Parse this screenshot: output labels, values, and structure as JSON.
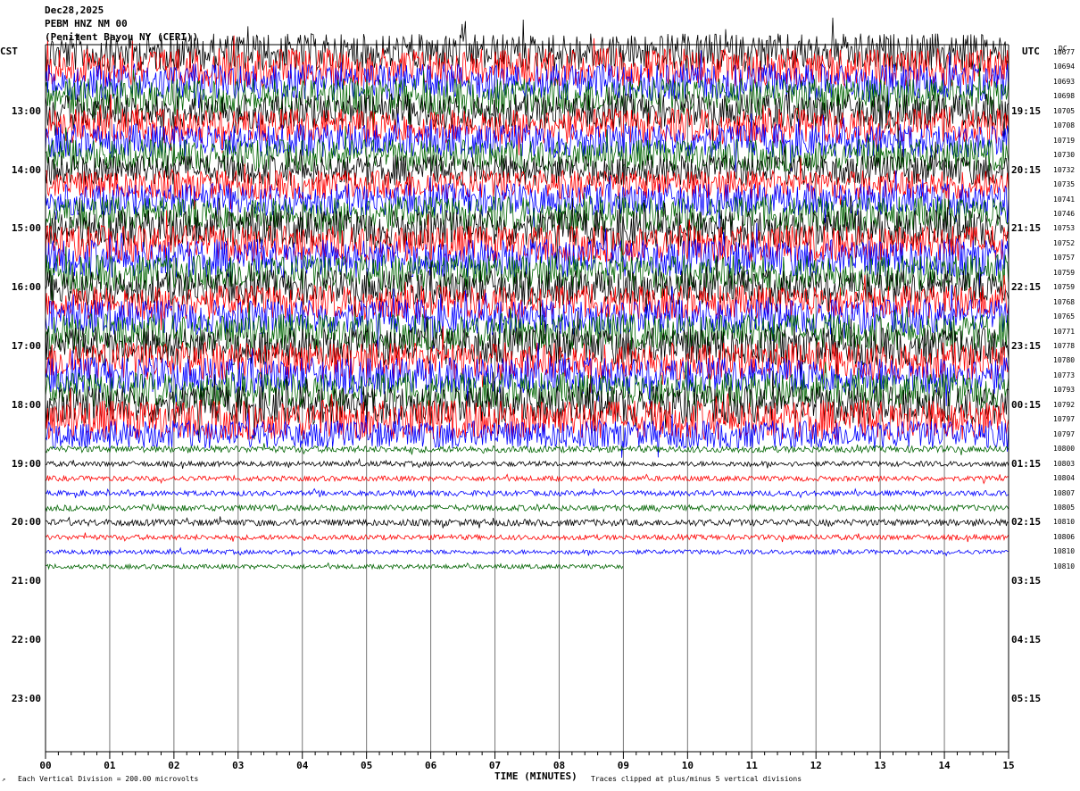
{
  "header": {
    "date": "Dec28,2025",
    "station": "PEBM HNZ NM 00",
    "location": "(Penitent Bayou NY (CERI))"
  },
  "tz_left": "CST",
  "tz_right": "UTC",
  "dc_header": "DC",
  "colors": {
    "sequence": [
      "#000000",
      "#ff0000",
      "#0000ff",
      "#006400"
    ]
  },
  "chart_data": {
    "type": "helicorder",
    "title": "",
    "xlabel": "TIME (MINUTES)",
    "x_ticks": [
      "00",
      "01",
      "02",
      "03",
      "04",
      "05",
      "06",
      "07",
      "08",
      "09",
      "10",
      "11",
      "12",
      "13",
      "14",
      "15"
    ],
    "xlim": [
      0,
      15
    ],
    "rows_per_hour": 4,
    "row_minutes": 15,
    "start_time_local": "12:15",
    "left_hour_labels": [
      "13:00",
      "14:00",
      "15:00",
      "16:00",
      "17:00",
      "18:00",
      "19:00",
      "20:00",
      "21:00",
      "22:00",
      "23:00"
    ],
    "right_hour_labels": [
      "19:15",
      "20:15",
      "21:15",
      "22:15",
      "23:15",
      "00:15",
      "01:15",
      "02:15",
      "03:15",
      "04:15",
      "05:15"
    ],
    "dc_offsets": [
      10677,
      10694,
      10693,
      10698,
      10705,
      10708,
      10719,
      10730,
      10732,
      10735,
      10741,
      10746,
      10753,
      10752,
      10757,
      10759,
      10759,
      10768,
      10765,
      10771,
      10778,
      10780,
      10773,
      10793,
      10792,
      10797,
      10797,
      10800,
      10803,
      10804,
      10807,
      10805,
      10810,
      10806,
      10810,
      10810
    ],
    "trace_rows": 36,
    "last_row_end_minutes": 9,
    "amplitude_profile": [
      2.6,
      2.6,
      2.5,
      2.5,
      2.4,
      2.4,
      2.3,
      2.2,
      2.1,
      2.0,
      2.2,
      2.4,
      2.6,
      2.5,
      2.6,
      2.5,
      2.4,
      2.3,
      2.4,
      2.5,
      2.6,
      2.6,
      2.5,
      2.4,
      2.6,
      2.7,
      1.9,
      0.45,
      0.35,
      0.35,
      0.35,
      0.4,
      0.45,
      0.35,
      0.3,
      0.3
    ],
    "scale_note": "Each Vertical Division =  200.00 microvolts",
    "clip_note": "Traces clipped at plus/minus 5 vertical divisions"
  }
}
